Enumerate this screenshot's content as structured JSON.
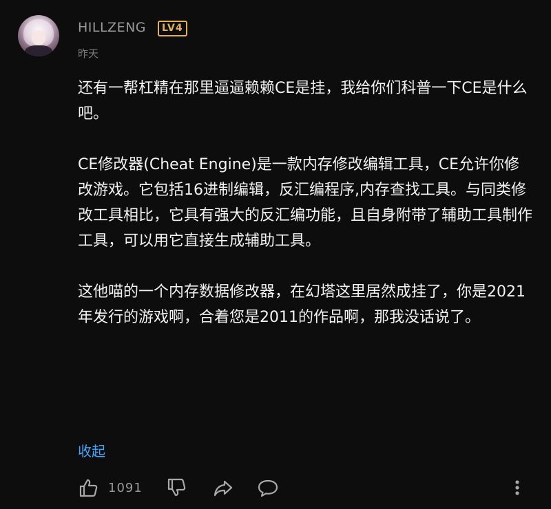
{
  "author": {
    "name": "HILLZENG",
    "level": "LV4",
    "time": "昨天"
  },
  "comment": {
    "paragraphs": [
      "还有一帮杠精在那里逼逼赖赖CE是挂，我给你们科普一下CE是什么吧。",
      "CE修改器(Cheat Engine)是一款内存修改编辑工具，CE允许你修改游戏。它包括16进制编辑，反汇编程序,内存查找工具。与同类修改工具相比，它具有强大的反汇编功能，且自身附带了辅助工具制作工具，可以用它直接生成辅助工具。",
      "这他喵的一个内存数据修改器，在幻塔这里居然成挂了，你是2021年发行的游戏啊，合着您是2011的作品啊，那我没话说了。"
    ],
    "collapse_label": "收起"
  },
  "actions": {
    "like_count": "1091",
    "icons": [
      "thumbs-up-icon",
      "thumbs-down-icon",
      "share-icon",
      "reply-icon",
      "more-icon"
    ]
  },
  "colors": {
    "background": "#0d0d0d",
    "text": "#f2f2f2",
    "meta": "#9a9a9a",
    "level_badge": "#e3b24f",
    "link": "#3ea6ff"
  }
}
